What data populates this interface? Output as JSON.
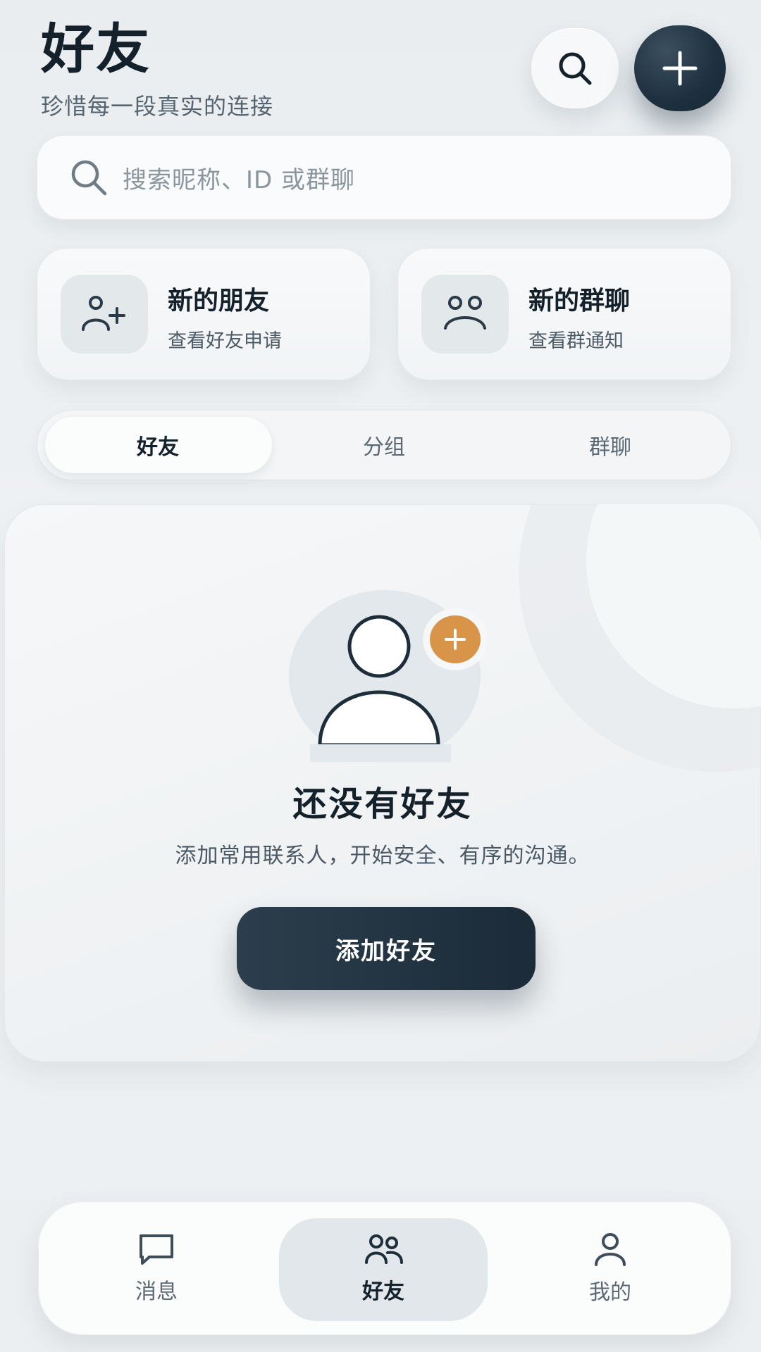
{
  "header": {
    "title": "好友",
    "subtitle": "珍惜每一段真实的连接",
    "search_icon": "search-icon",
    "add_icon": "plus-icon"
  },
  "search": {
    "placeholder": "搜索昵称、ID 或群聊"
  },
  "quick_actions": [
    {
      "title": "新的朋友",
      "subtitle": "查看好友申请",
      "icon": "add-person-icon"
    },
    {
      "title": "新的群聊",
      "subtitle": "查看群通知",
      "icon": "group-icon"
    }
  ],
  "tabs": [
    {
      "label": "好友",
      "active": true
    },
    {
      "label": "分组",
      "active": false
    },
    {
      "label": "群聊",
      "active": false
    }
  ],
  "empty_state": {
    "title": "还没有好友",
    "description": "添加常用联系人，开始安全、有序的沟通。",
    "button_label": "添加好友"
  },
  "bottom_nav": [
    {
      "label": "消息",
      "icon": "chat-icon",
      "active": false
    },
    {
      "label": "好友",
      "icon": "friends-icon",
      "active": true
    },
    {
      "label": "我的",
      "icon": "profile-icon",
      "active": false
    }
  ],
  "colors": {
    "primary_dark": "#1e303f",
    "accent_orange": "#d8954a",
    "background": "#eceff1"
  }
}
